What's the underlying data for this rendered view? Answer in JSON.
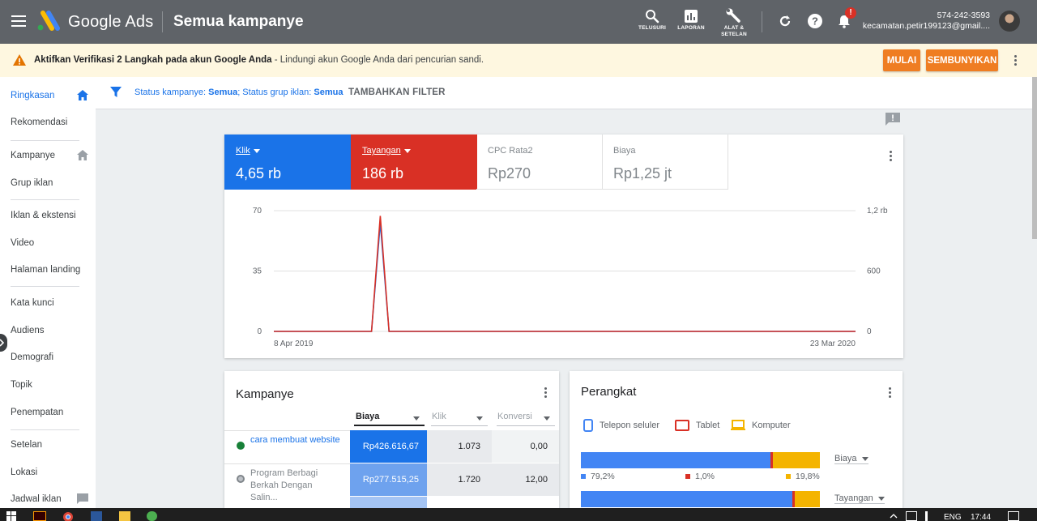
{
  "header": {
    "brand": "Google Ads",
    "title": "Semua kampanye",
    "tools": [
      {
        "icon": "search-icon",
        "label": "TELUSURI"
      },
      {
        "icon": "reports-icon",
        "label": "LAPORAN"
      },
      {
        "icon": "wrench-icon",
        "label_1": "ALAT &",
        "label_2": "SETELAN"
      }
    ],
    "notification_badge": "!",
    "account_id": "574-242-3593",
    "account_email": "kecamatan.petir199123@gmail...."
  },
  "banner": {
    "bold": "Aktifkan Verifikasi 2 Langkah pada akun Google Anda",
    "rest": " - Lindungi akun Google Anda dari pencurian sandi.",
    "start_button": "MULAI",
    "hide_button": "SEMBUNYIKAN",
    "accent": "#ef7d22"
  },
  "sidebar": {
    "items": [
      {
        "label": "Ringkasan"
      },
      {
        "label": "Rekomendasi"
      },
      {
        "label": "Kampanye"
      },
      {
        "label": "Grup iklan"
      },
      {
        "label": "Iklan & ekstensi"
      },
      {
        "label": "Video"
      },
      {
        "label": "Halaman landing"
      },
      {
        "label": "Kata kunci"
      },
      {
        "label": "Audiens"
      },
      {
        "label": "Demografi"
      },
      {
        "label": "Topik"
      },
      {
        "label": "Penempatan"
      },
      {
        "label": "Setelan"
      },
      {
        "label": "Lokasi"
      },
      {
        "label": "Jadwal iklan"
      }
    ]
  },
  "filter": {
    "status_campaign_label": "Status kampanye: ",
    "status_campaign_value": "Semua",
    "status_group_label": "; Status grup iklan: ",
    "status_group_value": "Semua",
    "add_filter": "TAMBAHKAN FILTER"
  },
  "metrics": [
    {
      "label": "Klik",
      "value": "4,65 rb",
      "color": "#1a73e8"
    },
    {
      "label": "Tayangan",
      "value": "186 rb",
      "color": "#d93025"
    },
    {
      "label": "CPC Rata2",
      "value": "Rp270"
    },
    {
      "label": "Biaya",
      "value": "Rp1,25 jt"
    }
  ],
  "chart_data": {
    "type": "line",
    "x_start_label": "8 Apr 2019",
    "x_end_label": "23 Mar 2020",
    "left_ticks": [
      "70",
      "35",
      "0"
    ],
    "right_ticks": [
      "1,2 rb",
      "600",
      "0"
    ],
    "ylim_left": [
      0,
      70
    ],
    "series": [
      {
        "name": "Klik",
        "color": "#1a73e8",
        "points": [
          [
            0,
            0
          ],
          [
            0.168,
            0
          ],
          [
            0.183,
            63
          ],
          [
            0.198,
            0
          ],
          [
            1,
            0
          ]
        ]
      },
      {
        "name": "Tayangan",
        "color": "#d93025",
        "points": [
          [
            0,
            0
          ],
          [
            0.168,
            0
          ],
          [
            0.183,
            67
          ],
          [
            0.198,
            0
          ],
          [
            1,
            0
          ]
        ]
      }
    ]
  },
  "campaigns": {
    "title": "Kampanye",
    "columns": [
      "Biaya",
      "Klik",
      "Konversi"
    ],
    "rows": [
      {
        "name": "cara membuat website",
        "cost": "Rp426.616,67",
        "clicks": "1.073",
        "conv": "0,00",
        "status": "enabled",
        "status_color": "#188038"
      },
      {
        "name": "Program Berbagi Berkah Dengan Salin...",
        "cost": "Rp277.515,25",
        "clicks": "1.720",
        "conv": "12,00",
        "status": "removed",
        "status_color": "#80868b"
      }
    ]
  },
  "devices": {
    "title": "Perangkat",
    "legend": [
      {
        "icon": "phone-icon",
        "label": "Telepon seluler",
        "color": "#4285f4"
      },
      {
        "icon": "tablet-icon",
        "label": "Tablet",
        "color": "#d93025"
      },
      {
        "icon": "computer-icon",
        "label": "Komputer",
        "color": "#f4b400"
      }
    ],
    "cost_select": "Biaya",
    "impr_select": "Tayangan",
    "cost_split": [
      79.2,
      1.0,
      19.8
    ],
    "cost_labels": [
      "79,2%",
      "1,0%",
      "19,8%"
    ],
    "impr_split": [
      88.4,
      1.0,
      10.6
    ]
  },
  "taskbar": {
    "lang": "ENG",
    "time": "17:44"
  }
}
